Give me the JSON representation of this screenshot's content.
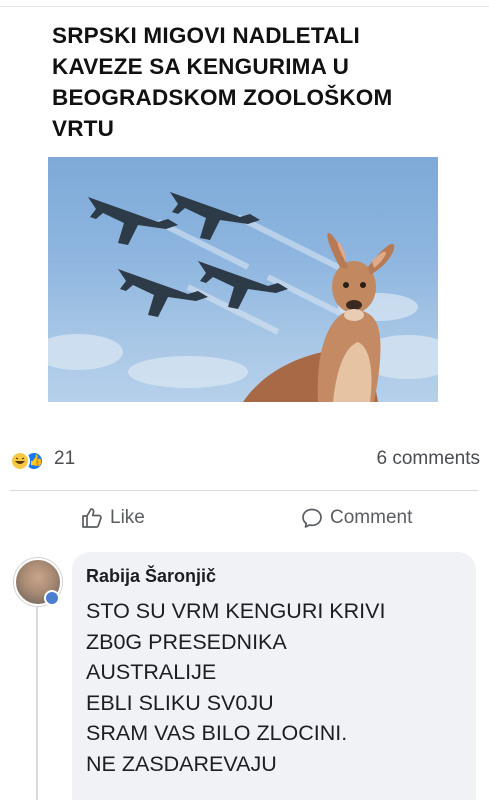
{
  "post": {
    "headline": "SRPSKI MIGOVI NADLETALI\nKAVEZE SA KENGURIMA U\nBEOGRADSKOM ZOOLOŠKOM\nVRTU",
    "image_subject": "four fighter jets flying over a kangaroo"
  },
  "reactions": {
    "icons": [
      "haha-icon",
      "like-icon"
    ],
    "count": "21",
    "comments_count": "6 comments"
  },
  "actions": {
    "like_label": "Like",
    "comment_label": "Comment"
  },
  "comment": {
    "author": "Rabija Šaronjič",
    "text": "STO SU VRM KENGURI KRIVI\nZB0G PRESEDNIKA\nAUSTRALIJE\nEBLI SLIKU  SV0JU\nSRAM VAS BILO ZLOCINI.\nNE ZASDAREVAJU"
  },
  "colors": {
    "like_blue": "#1877f2",
    "haha_yellow": "#f7c843",
    "bubble_bg": "#f0f2f5"
  }
}
